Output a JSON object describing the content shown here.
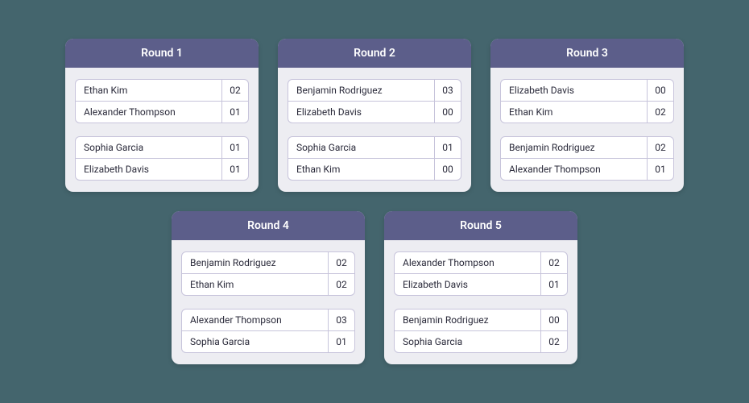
{
  "rounds": [
    {
      "title": "Round 1",
      "matches": [
        {
          "players": [
            {
              "name": "Ethan Kim",
              "score": "02"
            },
            {
              "name": "Alexander Thompson",
              "score": "01"
            }
          ]
        },
        {
          "players": [
            {
              "name": "Sophia Garcia",
              "score": "01"
            },
            {
              "name": "Elizabeth Davis",
              "score": "01"
            }
          ]
        }
      ]
    },
    {
      "title": "Round 2",
      "matches": [
        {
          "players": [
            {
              "name": "Benjamin Rodriguez",
              "score": "03"
            },
            {
              "name": "Elizabeth Davis",
              "score": "00"
            }
          ]
        },
        {
          "players": [
            {
              "name": "Sophia Garcia",
              "score": "01"
            },
            {
              "name": "Ethan Kim",
              "score": "00"
            }
          ]
        }
      ]
    },
    {
      "title": "Round 3",
      "matches": [
        {
          "players": [
            {
              "name": "Elizabeth Davis",
              "score": "00"
            },
            {
              "name": "Ethan Kim",
              "score": "02"
            }
          ]
        },
        {
          "players": [
            {
              "name": "Benjamin Rodriguez",
              "score": "02"
            },
            {
              "name": "Alexander Thompson",
              "score": "01"
            }
          ]
        }
      ]
    },
    {
      "title": "Round 4",
      "matches": [
        {
          "players": [
            {
              "name": "Benjamin Rodriguez",
              "score": "02"
            },
            {
              "name": "Ethan Kim",
              "score": "02"
            }
          ]
        },
        {
          "players": [
            {
              "name": "Alexander Thompson",
              "score": "03"
            },
            {
              "name": "Sophia Garcia",
              "score": "01"
            }
          ]
        }
      ]
    },
    {
      "title": "Round 5",
      "matches": [
        {
          "players": [
            {
              "name": "Alexander Thompson",
              "score": "02"
            },
            {
              "name": "Elizabeth Davis",
              "score": "01"
            }
          ]
        },
        {
          "players": [
            {
              "name": "Benjamin Rodriguez",
              "score": "00"
            },
            {
              "name": "Sophia Garcia",
              "score": "02"
            }
          ]
        }
      ]
    }
  ]
}
